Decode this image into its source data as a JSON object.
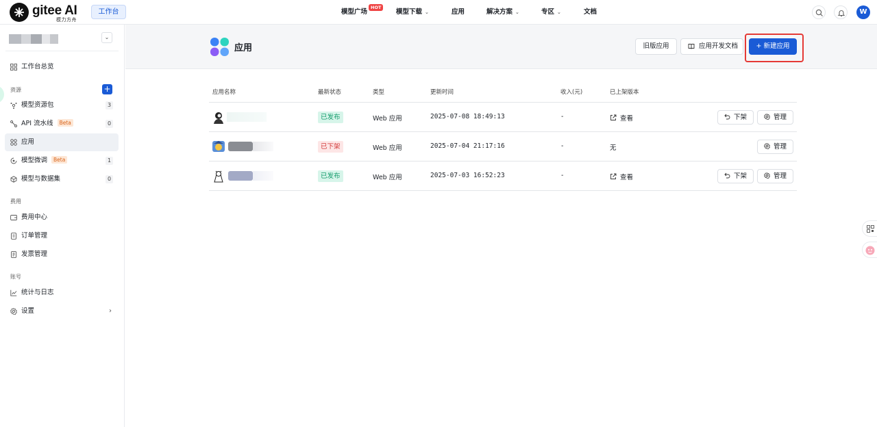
{
  "header": {
    "brand": "gitee AI",
    "brand_sub": "模力方舟",
    "workbench_label": "工作台",
    "nav": [
      {
        "label": "模型广场",
        "badge": "HOT"
      },
      {
        "label": "模型下载",
        "dropdown": true
      },
      {
        "label": "应用"
      },
      {
        "label": "解决方案",
        "dropdown": true
      },
      {
        "label": "专区",
        "dropdown": true
      },
      {
        "label": "文档"
      }
    ],
    "avatar_initial": "W",
    "icons": [
      "search-icon",
      "bell-icon"
    ]
  },
  "sidebar": {
    "overview": "工作台总览",
    "groups": {
      "resources": "资源",
      "billing": "费用",
      "account": "账号"
    },
    "items": {
      "model_packages": {
        "label": "模型资源包",
        "count": "3"
      },
      "api_pipeline": {
        "label": "API 流水线",
        "badge": "Beta",
        "count": "0"
      },
      "apps": {
        "label": "应用"
      },
      "finetune": {
        "label": "模型微调",
        "badge": "Beta",
        "count": "1"
      },
      "models_datasets": {
        "label": "模型与数据集",
        "count": "0"
      },
      "billing_center": {
        "label": "费用中心"
      },
      "orders": {
        "label": "订单管理"
      },
      "invoices": {
        "label": "发票管理"
      },
      "stats_logs": {
        "label": "统计与日志"
      },
      "settings": {
        "label": "设置"
      }
    }
  },
  "main": {
    "title": "应用",
    "buttons": {
      "legacy": "旧版应用",
      "docs": "应用开发文档",
      "create": "+ 新建应用"
    },
    "table": {
      "columns": {
        "name": "应用名称",
        "status": "最新状态",
        "type": "类型",
        "updated": "更新时间",
        "revenue": "收入(元)",
        "version": "已上架版本"
      },
      "rows": [
        {
          "status": "已发布",
          "status_kind": "published",
          "type": "Web 应用",
          "updated": "2025-07-08 18:49:13",
          "revenue": "-",
          "version": "查看",
          "actions": [
            "下架",
            "管理"
          ]
        },
        {
          "status": "已下架",
          "status_kind": "unpublished",
          "type": "Web 应用",
          "updated": "2025-07-04 21:17:16",
          "revenue": "-",
          "version": "无",
          "actions": [
            "管理"
          ]
        },
        {
          "status": "已发布",
          "status_kind": "published",
          "type": "Web 应用",
          "updated": "2025-07-03 16:52:23",
          "revenue": "-",
          "version": "查看",
          "actions": [
            "下架",
            "管理"
          ]
        }
      ]
    }
  },
  "colors": {
    "primary": "#1a5bd6",
    "published": "#149b6b",
    "unpublished": "#d33a3a",
    "highlight": "#e53935"
  }
}
